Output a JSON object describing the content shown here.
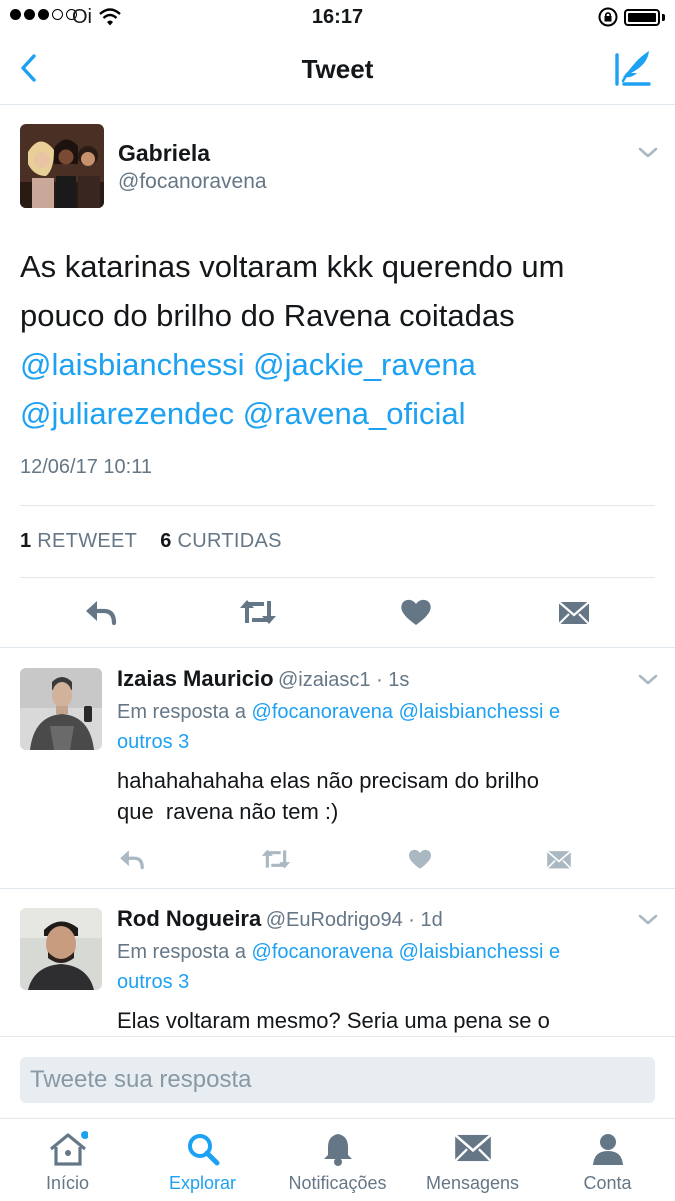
{
  "status_bar": {
    "carrier": "Oi",
    "time": "16:17"
  },
  "nav": {
    "title": "Tweet"
  },
  "main_tweet": {
    "name": "Gabriela",
    "handle": "@focanoravena",
    "text_line1": "As katarinas voltaram kkk querendo um",
    "text_line2": "pouco do brilho do Ravena coitadas",
    "mentions": [
      "@laisbianchessi",
      "@jackie_ravena",
      "@juliarezendec",
      "@ravena_oficial"
    ],
    "timestamp": "12/06/17 10:11",
    "retweet_count": "1",
    "retweet_label": "RETWEET",
    "like_count": "6",
    "like_label": "CURTIDAS"
  },
  "replies": [
    {
      "name": "Izaias Mauricio",
      "handle_time": "@izaiasc1 · 1s",
      "reply_to_prefix": "Em resposta a",
      "reply_to_mention1": "@focanoravena",
      "reply_to_mention2": "@laisbianchessi",
      "reply_to_suffix": "e",
      "reply_to_others": "outros 3",
      "text_line1": "hahahahahaha elas não precisam do brilho",
      "text_line2": "que  ravena não tem :)"
    },
    {
      "name": "Rod Nogueira",
      "handle_time": "@EuRodrigo94 · 1d",
      "reply_to_prefix": "Em resposta a",
      "reply_to_mention1": "@focanoravena",
      "reply_to_mention2": "@laisbianchessi",
      "reply_to_suffix": "e",
      "reply_to_others": "outros 3",
      "text_line1": "Elas voltaram mesmo? Seria uma pena se o"
    }
  ],
  "reply_input": {
    "placeholder": "Tweete sua resposta"
  },
  "tabs": [
    {
      "label": "Início",
      "icon": "home-icon"
    },
    {
      "label": "Explorar",
      "icon": "search-icon"
    },
    {
      "label": "Notificações",
      "icon": "bell-icon"
    },
    {
      "label": "Mensagens",
      "icon": "envelope-icon"
    },
    {
      "label": "Conta",
      "icon": "person-icon"
    }
  ],
  "colors": {
    "accent": "#1da1f2",
    "secondary_text": "#657786",
    "action_icon": "#657786",
    "divider": "#e1e8ed"
  }
}
